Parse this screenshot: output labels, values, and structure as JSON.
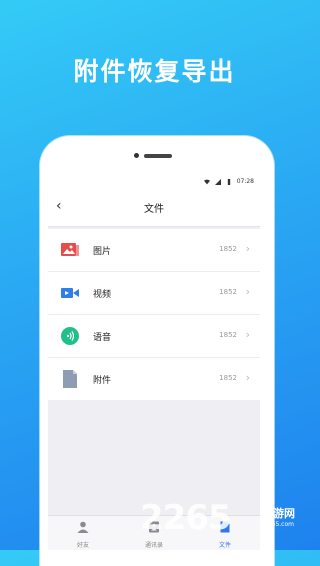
{
  "headline": "附件恢复导出",
  "status": {
    "time": "07:28"
  },
  "nav": {
    "back": "‹",
    "title": "文件"
  },
  "rows": [
    {
      "label": "图片",
      "count": "1852",
      "icon": "image-icon",
      "color": "#e84b4b"
    },
    {
      "label": "视频",
      "count": "1852",
      "icon": "video-icon",
      "color": "#2f7fe6"
    },
    {
      "label": "语音",
      "count": "1852",
      "icon": "voice-icon",
      "color": "#21c08b"
    },
    {
      "label": "附件",
      "count": "1852",
      "icon": "file-icon",
      "color": "#8f9db3"
    }
  ],
  "tabs": [
    {
      "label": "好友",
      "icon": "person-icon"
    },
    {
      "label": "通讯录",
      "icon": "contacts-icon"
    },
    {
      "label": "文件",
      "icon": "file-tab-icon",
      "active": true
    }
  ],
  "watermark": {
    "logo": "2265",
    "suffix": "手游网",
    "url": "2265.com"
  }
}
